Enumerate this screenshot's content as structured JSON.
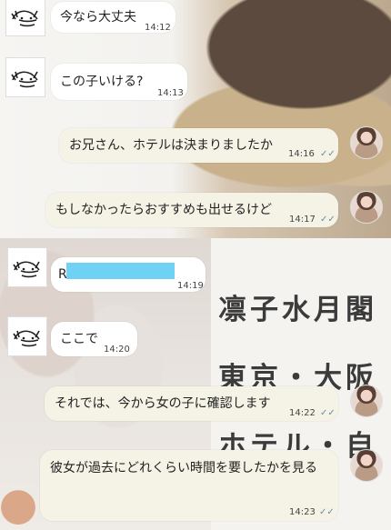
{
  "messages": [
    {
      "text": "今なら大丈夫",
      "time": "14:12"
    },
    {
      "text": "この子いける?",
      "time": "14:13"
    },
    {
      "text": "お兄さん、ホテルは決まりましたか",
      "time": "14:16"
    },
    {
      "text": "もしなかったらおすすめも出せるけど",
      "time": "14:17"
    },
    {
      "text": "R",
      "time": "14:19"
    },
    {
      "text": "ここで",
      "time": "14:20"
    },
    {
      "text": "それでは、今から女の子に確認します",
      "time": "14:22"
    },
    {
      "text": "彼女が過去にどれくらい時間を要したかを見る",
      "time": "14:23"
    }
  ],
  "poster": {
    "line1": "凛子水月閣",
    "line2": "東京・大阪",
    "line3": "ホテル・自宅"
  },
  "colors": {
    "bubble_left": "#ffffff",
    "bubble_right": "#f5f3e6",
    "redaction": "#6fd2f5"
  },
  "icons": {
    "sender_avatar": "cat-sketch-avatar",
    "receiver_avatar": "profile-photo-avatar",
    "read_receipt": "double-check-icon"
  }
}
